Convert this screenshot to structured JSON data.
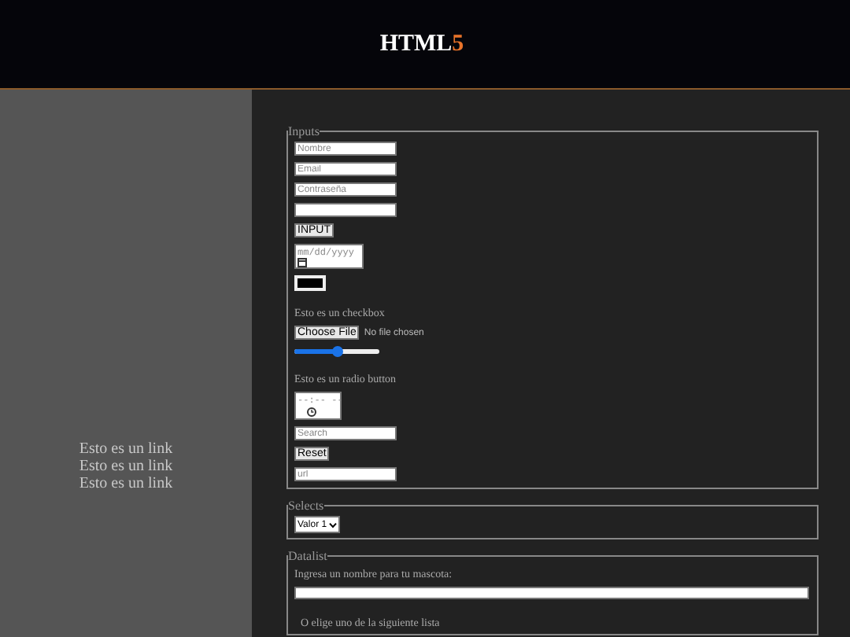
{
  "header": {
    "title": "HTML",
    "title_accent": "5"
  },
  "sidebar": {
    "links": [
      "Esto es un link",
      "Esto es un link",
      "Esto es un link"
    ]
  },
  "fieldsets": [
    {
      "legend": "Inputs",
      "controls": [
        {
          "kind": "text",
          "placeholder": "Nombre"
        },
        {
          "kind": "text",
          "placeholder": "Email"
        },
        {
          "kind": "text",
          "placeholder": "Contraseña"
        },
        {
          "kind": "text"
        },
        {
          "kind": "button",
          "label": "INPUT"
        },
        {
          "kind": "date",
          "placeholder": "mm/dd/yyyy"
        },
        {
          "kind": "color",
          "color": "#000000"
        },
        {
          "kind": "label",
          "text": "Esto es un checkbox"
        },
        {
          "kind": "file",
          "label": "Choose File",
          "status": "No file chosen"
        },
        {
          "kind": "range",
          "level": 0.5
        },
        {
          "kind": "label",
          "text": "Esto es un radio button"
        },
        {
          "kind": "time",
          "placeholder": "--:-- --"
        },
        {
          "kind": "text",
          "placeholder": "Search"
        },
        {
          "kind": "button",
          "label": "Reset"
        },
        {
          "kind": "text",
          "placeholder": "url"
        }
      ]
    },
    {
      "legend": "Selects",
      "controls": [
        {
          "kind": "select",
          "value": "Valor 1"
        }
      ]
    },
    {
      "legend": "Datalist",
      "controls": [
        {
          "kind": "label",
          "text": "Ingresa un nombre para tu mascota:"
        },
        {
          "kind": "wide-text"
        },
        {
          "kind": "note",
          "text": "O elige uno de la siguiente lista"
        }
      ]
    }
  ]
}
